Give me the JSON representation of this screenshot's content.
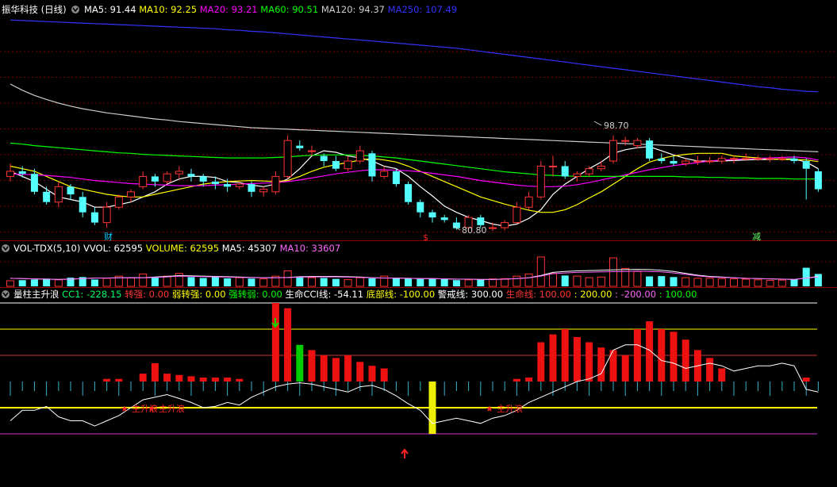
{
  "header": {
    "stock_title": "振华科技 (日线)",
    "ma": [
      {
        "label": "MA5: 91.44",
        "color": "#ffffff"
      },
      {
        "label": "MA10: 92.25",
        "color": "#ffff00"
      },
      {
        "label": "MA20: 93.21",
        "color": "#ff00ff"
      },
      {
        "label": "MA60: 90.51",
        "color": "#00ff00"
      },
      {
        "label": "MA120: 94.37",
        "color": "#cccccc"
      },
      {
        "label": "MA250: 107.49",
        "color": "#3333ff"
      }
    ]
  },
  "volume_header": {
    "title": "VOL-TDX(5,10)",
    "items": [
      {
        "label": "VVOL: 62595",
        "color": "#ffffff"
      },
      {
        "label": "VOLUME: 62595",
        "color": "#ffff00"
      },
      {
        "label": "MA5: 45307",
        "color": "#ffffff"
      },
      {
        "label": "MA10: 33607",
        "color": "#ff66ff"
      }
    ]
  },
  "indicator_header": {
    "title": "量柱主升浪",
    "items": [
      {
        "label": "CC1: -228.15",
        "color": "#00ff66"
      },
      {
        "label": "转强: 0.00",
        "color": "#ff3333"
      },
      {
        "label": "弱转强: 0.00",
        "color": "#ffff00"
      },
      {
        "label": "强转弱: 0.00",
        "color": "#00ff00"
      },
      {
        "label": "生命CCI线: -54.11",
        "color": "#ffffff"
      },
      {
        "label": "底部线: -100.00",
        "color": "#ffff00"
      },
      {
        "label": "警戒线: 300.00",
        "color": "#ffffff"
      },
      {
        "label": "生命线: 100.00",
        "color": "#ff3333"
      },
      {
        "label": ": 200.00",
        "color": "#ffff00"
      },
      {
        "label": ": -200.00",
        "color": "#ff66ff"
      },
      {
        "label": ": 100.00",
        "color": "#00ff00"
      }
    ]
  },
  "annotations": {
    "high_marker": "98.70",
    "low_marker": "80.80",
    "tag_cai": "财",
    "tag_dollar": "$",
    "tag_jian": "减",
    "signal_text": "主升浪"
  },
  "chart_data": {
    "type": "candlestick",
    "ohlc": [
      [
        91,
        92,
        93.5,
        90
      ],
      [
        92,
        91.5,
        93,
        90.8
      ],
      [
        91.5,
        88,
        92.5,
        87.5
      ],
      [
        88,
        86,
        89,
        85.5
      ],
      [
        86,
        89,
        90,
        85
      ],
      [
        89,
        87.5,
        89.5,
        86.5
      ],
      [
        87,
        84,
        88,
        83
      ],
      [
        84,
        82,
        85,
        81.5
      ],
      [
        82,
        85,
        86,
        81
      ],
      [
        85,
        87,
        87.5,
        84.5
      ],
      [
        87,
        88,
        88.5,
        86
      ],
      [
        89,
        91,
        92,
        88.5
      ],
      [
        91,
        90,
        91.5,
        89
      ],
      [
        90,
        91.5,
        92,
        89.5
      ],
      [
        91.5,
        92,
        93,
        90.5
      ],
      [
        91.5,
        91,
        92.5,
        90
      ],
      [
        91,
        90,
        91.5,
        89
      ],
      [
        90,
        89.5,
        91,
        88.5
      ],
      [
        89.5,
        89,
        90.5,
        88
      ],
      [
        89,
        89.5,
        90,
        88.5
      ],
      [
        89.5,
        88,
        90,
        87
      ],
      [
        88,
        88.5,
        89,
        87
      ],
      [
        88,
        91,
        92,
        87.5
      ],
      [
        91,
        98,
        99,
        90.5
      ],
      [
        97,
        96.5,
        98,
        96
      ],
      [
        96,
        96,
        97,
        95
      ],
      [
        95,
        94,
        95.5,
        93
      ],
      [
        94,
        92.5,
        95,
        92
      ],
      [
        92.5,
        94,
        95,
        92
      ],
      [
        94,
        96,
        97,
        93.5
      ],
      [
        95.5,
        91,
        96,
        90
      ],
      [
        91,
        92,
        93,
        90.5
      ],
      [
        92,
        89.5,
        92.5,
        89
      ],
      [
        89.5,
        86,
        90,
        85.5
      ],
      [
        86,
        84,
        86.5,
        83
      ],
      [
        84,
        83,
        84.5,
        82
      ],
      [
        83,
        82.5,
        83.5,
        82
      ],
      [
        82,
        80.9,
        83,
        80.6
      ],
      [
        81,
        83,
        83.5,
        80.5
      ],
      [
        83,
        81.5,
        83.5,
        81
      ],
      [
        81,
        81,
        82,
        80.4
      ],
      [
        81,
        82,
        82.5,
        80.5
      ],
      [
        82,
        85,
        86,
        81.8
      ],
      [
        85,
        87,
        88,
        84.5
      ],
      [
        87,
        93,
        94,
        86.5
      ],
      [
        93,
        93,
        95,
        91
      ],
      [
        93,
        91,
        94,
        90.5
      ],
      [
        91,
        91.5,
        92,
        90
      ],
      [
        91.5,
        92.5,
        93,
        91
      ],
      [
        92.5,
        93,
        94,
        92
      ],
      [
        94,
        98,
        99,
        93.5
      ],
      [
        98,
        98,
        98.7,
        97
      ],
      [
        97,
        98,
        98.5,
        96.5
      ],
      [
        98,
        94.5,
        98.5,
        94
      ],
      [
        94.5,
        94,
        95.5,
        93.5
      ],
      [
        94,
        93.5,
        95,
        93
      ],
      [
        93.5,
        94,
        94.5,
        93
      ],
      [
        94,
        94,
        95,
        93.2
      ],
      [
        94,
        94,
        94.8,
        93.5
      ],
      [
        94,
        94.5,
        95,
        93.5
      ],
      [
        94.5,
        94.5,
        95,
        93.5
      ],
      [
        94.5,
        94.5,
        95.5,
        94
      ],
      [
        94.5,
        94.5,
        95,
        94
      ],
      [
        94.5,
        94.5,
        95,
        93.8
      ],
      [
        94.5,
        94.5,
        95,
        94
      ],
      [
        94.5,
        94,
        95,
        93.5
      ],
      [
        94,
        92.5,
        94.5,
        86.5
      ],
      [
        92,
        88.5,
        92.5,
        88
      ]
    ],
    "ma_lines": [
      {
        "name": "MA5",
        "color": "#ffffff",
        "values": [
          92,
          91,
          90,
          88.5,
          87,
          86.5,
          86,
          85,
          85,
          85.5,
          86,
          87,
          88,
          89.5,
          90.5,
          91,
          91,
          90.8,
          90,
          89.8,
          89.3,
          89,
          89.5,
          90.5,
          92.5,
          95,
          96,
          95.7,
          95,
          94.6,
          94,
          93,
          92.5,
          91,
          89,
          87.2,
          85.2,
          84,
          83,
          82.4,
          81.7,
          81.3,
          81.7,
          82.8,
          84.5,
          87.5,
          89.5,
          91,
          92.5,
          93.8,
          95.5,
          96.2,
          96.6,
          96.8,
          96,
          95.2,
          94.5,
          94,
          94,
          94,
          94.1,
          94.2,
          94.3,
          94.3,
          94.4,
          94.4,
          93.8,
          92.5
        ]
      },
      {
        "name": "MA10",
        "color": "#ffff00",
        "values": [
          93,
          92.5,
          92,
          91,
          90,
          89,
          88.5,
          88,
          87.5,
          87.2,
          87,
          87,
          87.5,
          88,
          88.5,
          89,
          89.5,
          89.8,
          90,
          90.1,
          90.2,
          90.1,
          90,
          90.2,
          91,
          92,
          92.8,
          93.3,
          93.7,
          94.2,
          94.5,
          94.2,
          93.8,
          93,
          92,
          91,
          90,
          89,
          88,
          87,
          86.3,
          85.6,
          85,
          84.4,
          84,
          84,
          84.5,
          85.5,
          86.8,
          88,
          89.5,
          91,
          92.5,
          93.8,
          94.5,
          95,
          95.3,
          95.5,
          95.5,
          95.5,
          95,
          94.8,
          94.6,
          94.4,
          94.3,
          94.3,
          94.2,
          93.9
        ]
      },
      {
        "name": "MA20",
        "color": "#ff00ff",
        "values": [
          91.5,
          91.4,
          91.3,
          91.2,
          91,
          90.8,
          90.5,
          90.2,
          90,
          89.8,
          89.6,
          89.5,
          89.4,
          89.3,
          89.2,
          89.2,
          89.2,
          89.3,
          89.4,
          89.5,
          89.6,
          89.7,
          89.8,
          90,
          90.3,
          90.7,
          91.1,
          91.5,
          91.8,
          92.1,
          92.3,
          92.3,
          92.2,
          92.1,
          91.9,
          91.6,
          91.3,
          91,
          90.6,
          90.2,
          89.9,
          89.6,
          89.3,
          89.1,
          89,
          89,
          89.1,
          89.4,
          89.8,
          90.3,
          90.8,
          91.3,
          91.8,
          92.3,
          92.7,
          93.1,
          93.4,
          93.7,
          94,
          94.2,
          94.3,
          94.4,
          94.5,
          94.6,
          94.7,
          94.8,
          94.6,
          94.2
        ]
      },
      {
        "name": "MA60",
        "color": "#00ff00",
        "values": [
          97.5,
          97.3,
          97,
          96.8,
          96.6,
          96.4,
          96.2,
          96,
          95.8,
          95.6,
          95.5,
          95.3,
          95.2,
          95.1,
          95,
          94.9,
          94.8,
          94.7,
          94.6,
          94.6,
          94.6,
          94.6,
          94.7,
          94.8,
          95,
          95.1,
          95.2,
          95.2,
          95.2,
          95.1,
          95,
          94.8,
          94.6,
          94.3,
          94,
          93.7,
          93.4,
          93.1,
          92.8,
          92.5,
          92.2,
          91.9,
          91.7,
          91.5,
          91.3,
          91.2,
          91.1,
          91,
          91,
          91,
          91,
          91,
          91,
          91,
          91,
          91,
          90.9,
          90.9,
          90.8,
          90.8,
          90.7,
          90.7,
          90.6,
          90.6,
          90.6,
          90.5,
          90.5,
          90.5
        ]
      },
      {
        "name": "MA120",
        "color": "#cccccc",
        "values": [
          109,
          107.8,
          106.8,
          106,
          105.3,
          104.7,
          104.2,
          103.8,
          103.4,
          103.1,
          102.8,
          102.5,
          102.2,
          102,
          101.7,
          101.5,
          101.3,
          101.1,
          100.9,
          100.7,
          100.5,
          100.4,
          100.3,
          100.2,
          100.1,
          100,
          99.9,
          99.8,
          99.7,
          99.6,
          99.5,
          99.4,
          99.3,
          99.2,
          99.1,
          99,
          98.9,
          98.8,
          98.7,
          98.6,
          98.5,
          98.4,
          98.3,
          98.2,
          98.1,
          98,
          97.9,
          97.8,
          97.7,
          97.6,
          97.5,
          97.4,
          97.3,
          97.2,
          97.1,
          97,
          96.9,
          96.8,
          96.7,
          96.6,
          96.5,
          96.4,
          96.3,
          96.2,
          96.1,
          96,
          95.9,
          95.8
        ]
      },
      {
        "name": "MA250",
        "color": "#3333ff",
        "values": [
          121.5,
          121.4,
          121.3,
          121.2,
          121.1,
          121,
          120.9,
          120.8,
          120.7,
          120.6,
          120.5,
          120.4,
          120.3,
          120.2,
          120.1,
          120,
          119.9,
          119.8,
          119.6,
          119.5,
          119.3,
          119.2,
          119,
          118.8,
          118.6,
          118.4,
          118.2,
          118,
          117.8,
          117.6,
          117.4,
          117.2,
          117,
          116.8,
          116.6,
          116.4,
          116.2,
          116,
          115.7,
          115.4,
          115.1,
          114.8,
          114.5,
          114.2,
          113.9,
          113.6,
          113.3,
          113,
          112.7,
          112.4,
          112.1,
          111.8,
          111.5,
          111.2,
          110.9,
          110.6,
          110.3,
          110,
          109.7,
          109.4,
          109.1,
          108.8,
          108.5,
          108.3,
          108,
          107.8,
          107.6,
          107.5
        ]
      }
    ],
    "volume": [
      18,
      20,
      22,
      25,
      21,
      28,
      30,
      22,
      26,
      33,
      27,
      40,
      28,
      33,
      42,
      30,
      27,
      31,
      26,
      28,
      25,
      24,
      33,
      50,
      30,
      28,
      27,
      24,
      22,
      28,
      26,
      33,
      28,
      25,
      24,
      25,
      23,
      20,
      21,
      22,
      24,
      25,
      33,
      40,
      95,
      42,
      35,
      33,
      28,
      30,
      92,
      58,
      48,
      32,
      33,
      30,
      28,
      26,
      26,
      25,
      24,
      23,
      21,
      19,
      20,
      22,
      60,
      40
    ],
    "vol_ma5": [
      26,
      25,
      24,
      23,
      22,
      23,
      25,
      27,
      27,
      28,
      28,
      28,
      30,
      32,
      35,
      34,
      33,
      32,
      31,
      30,
      29,
      28,
      28,
      29,
      31,
      32,
      32,
      32,
      31,
      30,
      28,
      27,
      27,
      26,
      25,
      25,
      24,
      23,
      23,
      22,
      22,
      23,
      25,
      28,
      35,
      45,
      48,
      50,
      51,
      52,
      53,
      54,
      55,
      54,
      52,
      48,
      42,
      36,
      32,
      30,
      28,
      26,
      25,
      24,
      23,
      22,
      27,
      32
    ]
  },
  "indicator_data": {
    "bar_values": [
      0,
      0,
      0,
      0,
      0,
      0,
      0,
      0,
      10,
      10,
      0,
      30,
      70,
      30,
      25,
      20,
      15,
      15,
      15,
      10,
      0,
      0,
      300,
      280,
      140,
      120,
      100,
      90,
      100,
      75,
      60,
      50,
      0,
      0,
      0,
      -200,
      0,
      0,
      0,
      0,
      0,
      0,
      10,
      15,
      150,
      180,
      200,
      170,
      150,
      130,
      120,
      100,
      200,
      230,
      200,
      190,
      160,
      120,
      90,
      50,
      0,
      0,
      0,
      0,
      0,
      0,
      15,
      0
    ],
    "bar_colors": [
      "r",
      "r",
      "r",
      "r",
      "r",
      "r",
      "r",
      "r",
      "r",
      "r",
      "r",
      "r",
      "r",
      "r",
      "r",
      "r",
      "r",
      "r",
      "r",
      "r",
      "r",
      "r",
      "r",
      "r",
      "g",
      "r",
      "r",
      "r",
      "r",
      "r",
      "r",
      "r",
      "r",
      "r",
      "r",
      "y",
      "r",
      "r",
      "r",
      "r",
      "r",
      "r",
      "r",
      "r",
      "r",
      "r",
      "r",
      "r",
      "r",
      "r",
      "r",
      "r",
      "r",
      "r",
      "r",
      "r",
      "r",
      "r",
      "r",
      "r",
      "r",
      "r",
      "r",
      "r",
      "r",
      "r",
      "r",
      "r"
    ],
    "cci_line": [
      -150,
      -110,
      -110,
      -95,
      -135,
      -150,
      -150,
      -170,
      -150,
      -130,
      -100,
      -70,
      -60,
      -50,
      -65,
      -80,
      -100,
      -95,
      -80,
      -90,
      -60,
      -40,
      -20,
      -10,
      -5,
      -10,
      -20,
      -30,
      -40,
      -20,
      -15,
      -30,
      -55,
      -85,
      -110,
      -160,
      -150,
      -140,
      -150,
      -160,
      -140,
      -130,
      -110,
      -80,
      -60,
      -40,
      -20,
      0,
      10,
      30,
      120,
      140,
      140,
      120,
      80,
      70,
      50,
      60,
      70,
      60,
      40,
      50,
      60,
      60,
      70,
      60,
      -30,
      -40
    ],
    "levels": [
      300,
      200,
      100,
      -100,
      -200
    ]
  }
}
